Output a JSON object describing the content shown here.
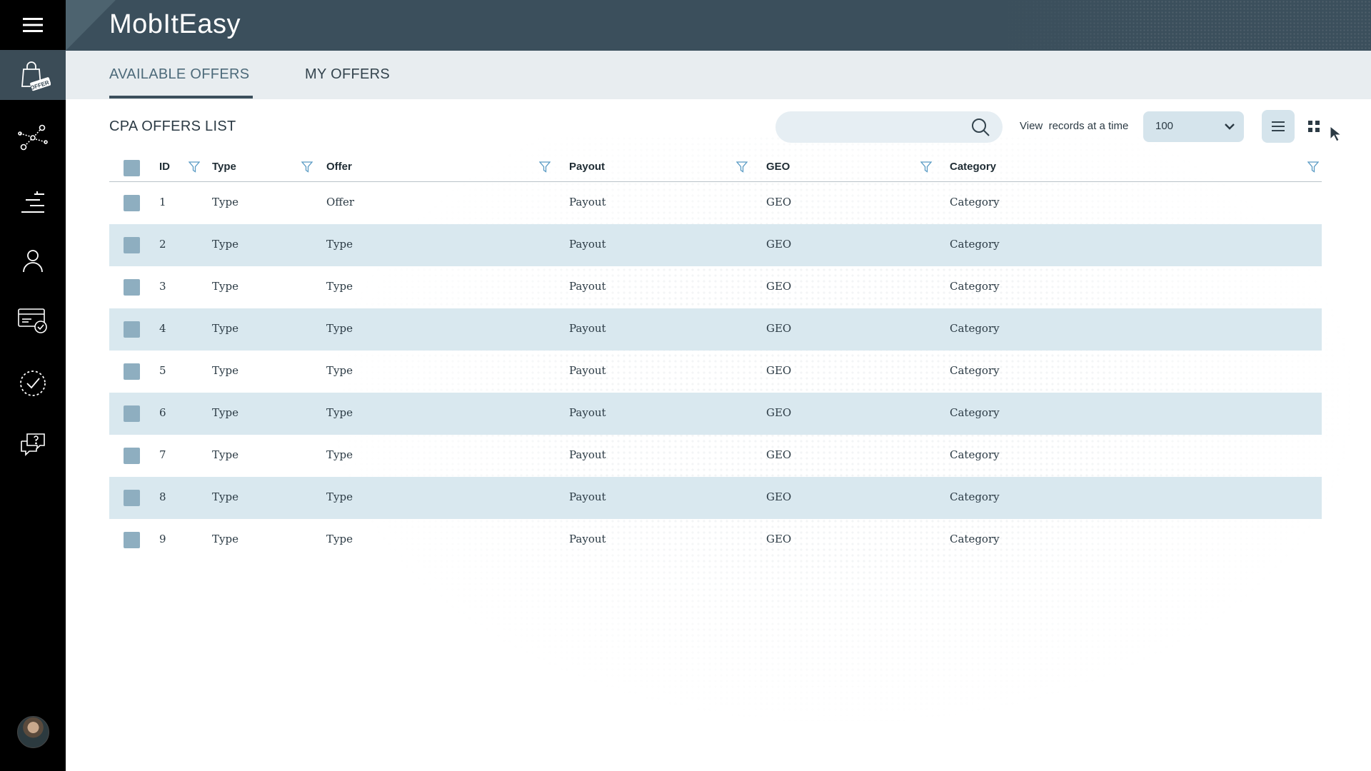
{
  "app": {
    "title": "MobItEasy"
  },
  "sidebar": {
    "items": [
      {
        "name": "menu",
        "icon": "hamburger-icon"
      },
      {
        "name": "offers",
        "icon": "shopping-bag-offer-icon",
        "badge": "OFFER",
        "active": true
      },
      {
        "name": "links",
        "icon": "network-links-icon"
      },
      {
        "name": "stats",
        "icon": "stats-bars-icon"
      },
      {
        "name": "user",
        "icon": "user-icon"
      },
      {
        "name": "billing",
        "icon": "billing-card-icon"
      },
      {
        "name": "tasks",
        "icon": "check-circle-icon"
      },
      {
        "name": "support",
        "icon": "support-chat-icon"
      }
    ],
    "avatar": "avatar"
  },
  "tabs": [
    {
      "label": "AVAILABLE OFFERS",
      "active": true
    },
    {
      "label": "MY OFFERS",
      "active": false
    }
  ],
  "list": {
    "title": "CPA OFFERS LIST",
    "search": {
      "value": "",
      "placeholder": ""
    },
    "view_label": "View  records at a time",
    "records_per_page": "100"
  },
  "table": {
    "columns": [
      "ID",
      "Type",
      "Offer",
      "Payout",
      "GEO",
      "Category"
    ],
    "rows": [
      {
        "id": "1",
        "type": "Type",
        "offer": "Offer",
        "payout": "Payout",
        "geo": "GEO",
        "category": "Category"
      },
      {
        "id": "2",
        "type": "Type",
        "offer": "Type",
        "payout": "Payout",
        "geo": "GEO",
        "category": "Category"
      },
      {
        "id": "3",
        "type": "Type",
        "offer": "Type",
        "payout": "Payout",
        "geo": "GEO",
        "category": "Category"
      },
      {
        "id": "4",
        "type": "Type",
        "offer": "Type",
        "payout": "Payout",
        "geo": "GEO",
        "category": "Category"
      },
      {
        "id": "5",
        "type": "Type",
        "offer": "Type",
        "payout": "Payout",
        "geo": "GEO",
        "category": "Category"
      },
      {
        "id": "6",
        "type": "Type",
        "offer": "Type",
        "payout": "Payout",
        "geo": "GEO",
        "category": "Category"
      },
      {
        "id": "7",
        "type": "Type",
        "offer": "Type",
        "payout": "Payout",
        "geo": "GEO",
        "category": "Category"
      },
      {
        "id": "8",
        "type": "Type",
        "offer": "Type",
        "payout": "Payout",
        "geo": "GEO",
        "category": "Category"
      },
      {
        "id": "9",
        "type": "Type",
        "offer": "Type",
        "payout": "Payout",
        "geo": "GEO",
        "category": "Category"
      }
    ]
  },
  "colors": {
    "rail": "#000000",
    "header": "#3b4f5c",
    "tabs_bg": "#e8edf0",
    "row_alt": "#d9e8ef",
    "checkbox": "#8eaec0",
    "accent": "#4d6a7a"
  }
}
